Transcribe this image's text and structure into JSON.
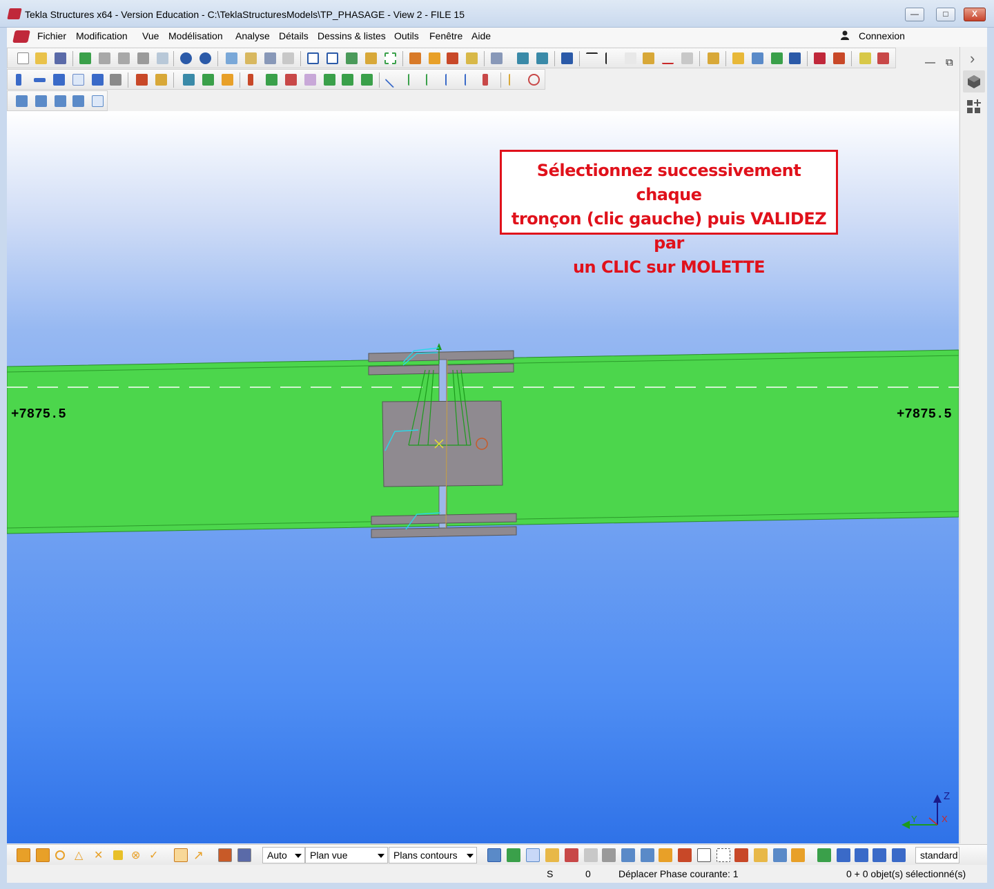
{
  "window": {
    "title": "Tekla Structures x64 - Version Education - C:\\TeklaStructuresModels\\TP_PHASAGE  - View 2 - FILE 15",
    "minimize": "—",
    "maximize": "□",
    "close": "X"
  },
  "menu": {
    "items": [
      "Fichier",
      "Modification",
      "Vue",
      "Modélisation",
      "Analyse",
      "Détails",
      "Dessins & listes",
      "Outils",
      "Fenêtre",
      "Aide"
    ],
    "connexion": "Connexion",
    "minimize": "—",
    "restore": "⧉",
    "close": "✕"
  },
  "right_panel": {
    "expand": "›"
  },
  "viewport": {
    "message": [
      "Sélectionnez successivement chaque",
      "tronçon (clic gauche) puis VALIDEZ par",
      "un CLIC sur MOLETTE"
    ],
    "elevation_left": "+7875.5",
    "elevation_right": "+7875.5"
  },
  "bottom_toolbar": {
    "select_auto": "Auto",
    "select_plan": "Plan vue",
    "select_contours": "Plans contours",
    "select_standard": "standard"
  },
  "statusbar": {
    "snap": "S",
    "count": "0",
    "command": "Déplacer Phase courante: 1",
    "selection": "0 + 0 objet(s) sélectionné(s)"
  },
  "colors": {
    "accent_red": "#e0111b",
    "member_green": "#4cd64c",
    "plate_gray": "#8f8a90"
  }
}
